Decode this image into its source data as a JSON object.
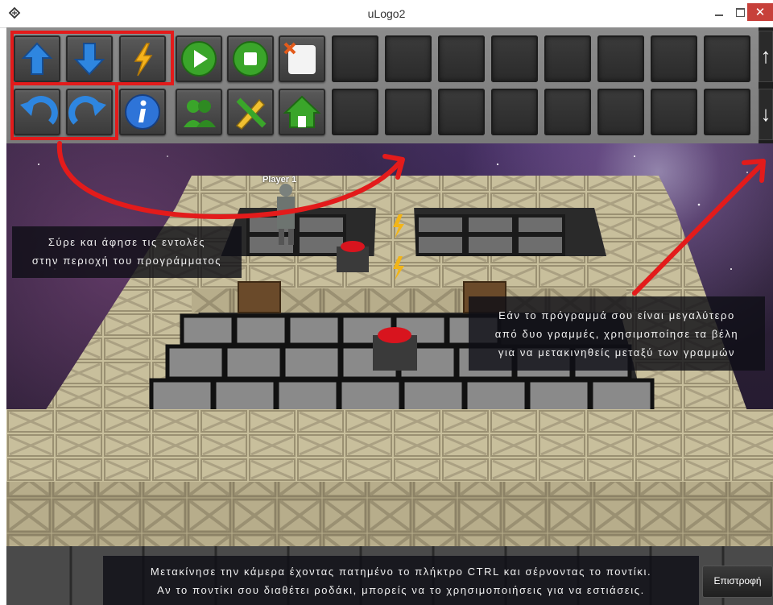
{
  "window": {
    "title": "uLogo2"
  },
  "toolbar": {
    "commands": [
      {
        "name": "forward-arrow-icon"
      },
      {
        "name": "backward-arrow-icon"
      },
      {
        "name": "lightning-icon"
      },
      {
        "name": "play-icon"
      },
      {
        "name": "stop-icon"
      },
      {
        "name": "clear-program-icon"
      },
      {
        "name": "turn-left-icon"
      },
      {
        "name": "turn-right-icon"
      },
      {
        "name": "info-icon"
      },
      {
        "name": "players-icon"
      },
      {
        "name": "edit-icon"
      },
      {
        "name": "home-icon"
      }
    ],
    "program_slots_per_row": 8,
    "scroll_up_label": "↑",
    "scroll_down_label": "↓"
  },
  "scene": {
    "player_label": "Player 1"
  },
  "hints": {
    "drag_drop": {
      "line1": "Σύρε και άφησε τις εντολές",
      "line2": "στην περιοχή του προγράμματος"
    },
    "scroll_rows": {
      "line1": "Εάν το πρόγραμμά σου είναι μεγαλύτερο",
      "line2": "από δυο γραμμές, χρησιμοποίησε τα βέλη",
      "line3": "για να μετακινηθείς μεταξύ των γραμμών"
    },
    "camera": {
      "line1": "Μετακίνησε την κάμερα έχοντας πατημένο το πλήκτρο CTRL και σέρνοντας το ποντίκι.",
      "line2": "Αν το ποντίκι σου διαθέτει ροδάκι, μπορείς να το χρησιμοποιήσεις για να εστιάσεις."
    }
  },
  "back_button": {
    "label": "Επιστροφή"
  },
  "colors": {
    "annotation_red": "#e31b1b",
    "close_button": "#c7403a"
  }
}
